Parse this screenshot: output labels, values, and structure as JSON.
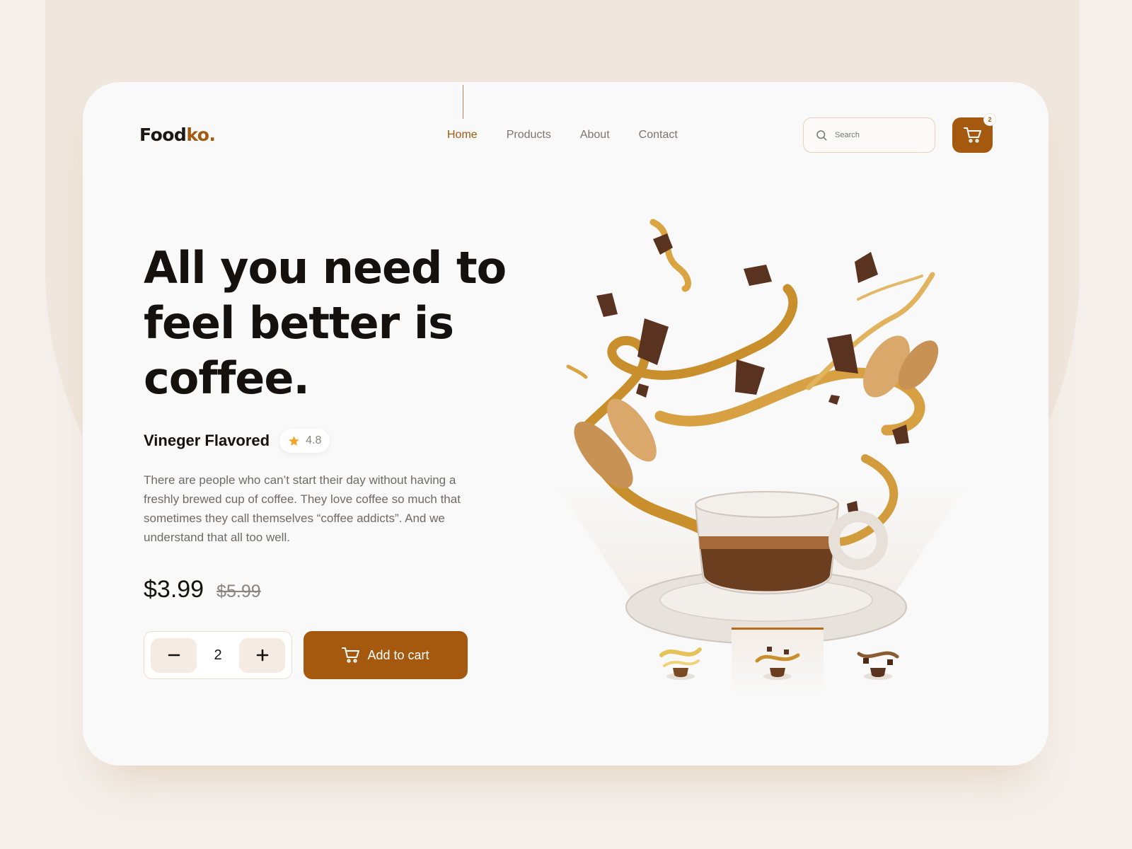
{
  "brand": {
    "name_main": "Food",
    "name_accent": "ko."
  },
  "nav": {
    "items": [
      {
        "label": "Home",
        "active": true
      },
      {
        "label": "Products",
        "active": false
      },
      {
        "label": "About",
        "active": false
      },
      {
        "label": "Contact",
        "active": false
      }
    ]
  },
  "search": {
    "placeholder": "Search",
    "icon": "search-icon"
  },
  "cart": {
    "count": "2",
    "icon": "cart-icon"
  },
  "hero": {
    "headline": "All you need to feel better is coffee.",
    "flavor": "Vineger Flavored",
    "rating": "4.8",
    "description": "There are people who can’t start their day without having a freshly brewed cup of coffee. They love coffee so much that sometimes they call themselves “coffee addicts”. And we understand that all too well.",
    "price": "$3.99",
    "old_price": "$5.99",
    "quantity": "2",
    "add_to_cart_label": "Add to cart"
  },
  "gallery": {
    "active_index": 1,
    "thumbnail_count": 3
  },
  "colors": {
    "accent": "#a4590f",
    "background": "#f4efea",
    "card": "#f9f9f9",
    "star": "#f5a524"
  }
}
